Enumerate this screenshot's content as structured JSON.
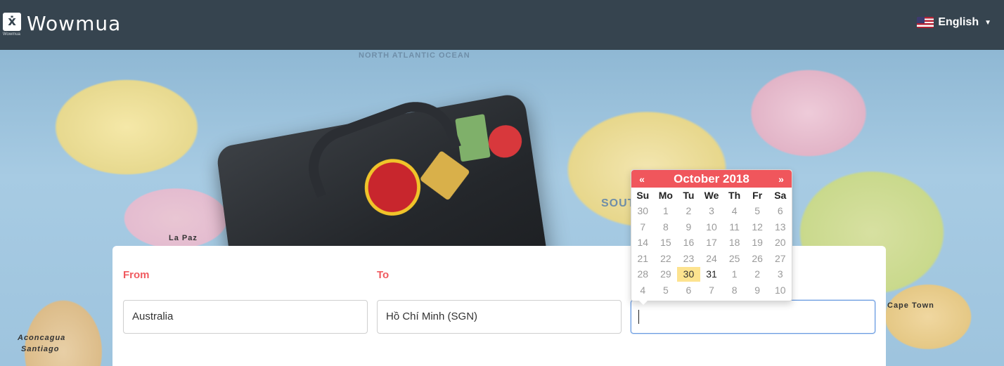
{
  "header": {
    "brand": "Wowmua",
    "logo_small_text": "Wowmua",
    "language": "English"
  },
  "search": {
    "from_label": "From",
    "to_label": "To",
    "from_value": "Australia",
    "to_value": "Hồ Chí Minh (SGN)",
    "date_value": ""
  },
  "calendar": {
    "prev": "«",
    "next": "»",
    "title": "October 2018",
    "weekdays": [
      "Su",
      "Mo",
      "Tu",
      "We",
      "Th",
      "Fr",
      "Sa"
    ],
    "weeks": [
      [
        "30",
        "1",
        "2",
        "3",
        "4",
        "5",
        "6"
      ],
      [
        "7",
        "8",
        "9",
        "10",
        "11",
        "12",
        "13"
      ],
      [
        "14",
        "15",
        "16",
        "17",
        "18",
        "19",
        "20"
      ],
      [
        "21",
        "22",
        "23",
        "24",
        "25",
        "26",
        "27"
      ],
      [
        "28",
        "29",
        "30",
        "31",
        "1",
        "2",
        "3"
      ],
      [
        "4",
        "5",
        "6",
        "7",
        "8",
        "9",
        "10"
      ]
    ],
    "today": "30",
    "current_month_days_visible": [
      "31"
    ],
    "accent": "#f0565c"
  },
  "map_labels": [
    "NORTH ATLANTIC OCEAN",
    "SOUTH ATLANTIC OCEAN",
    "Aconcagua",
    "Santiago",
    "Cape Town",
    "La Paz"
  ]
}
